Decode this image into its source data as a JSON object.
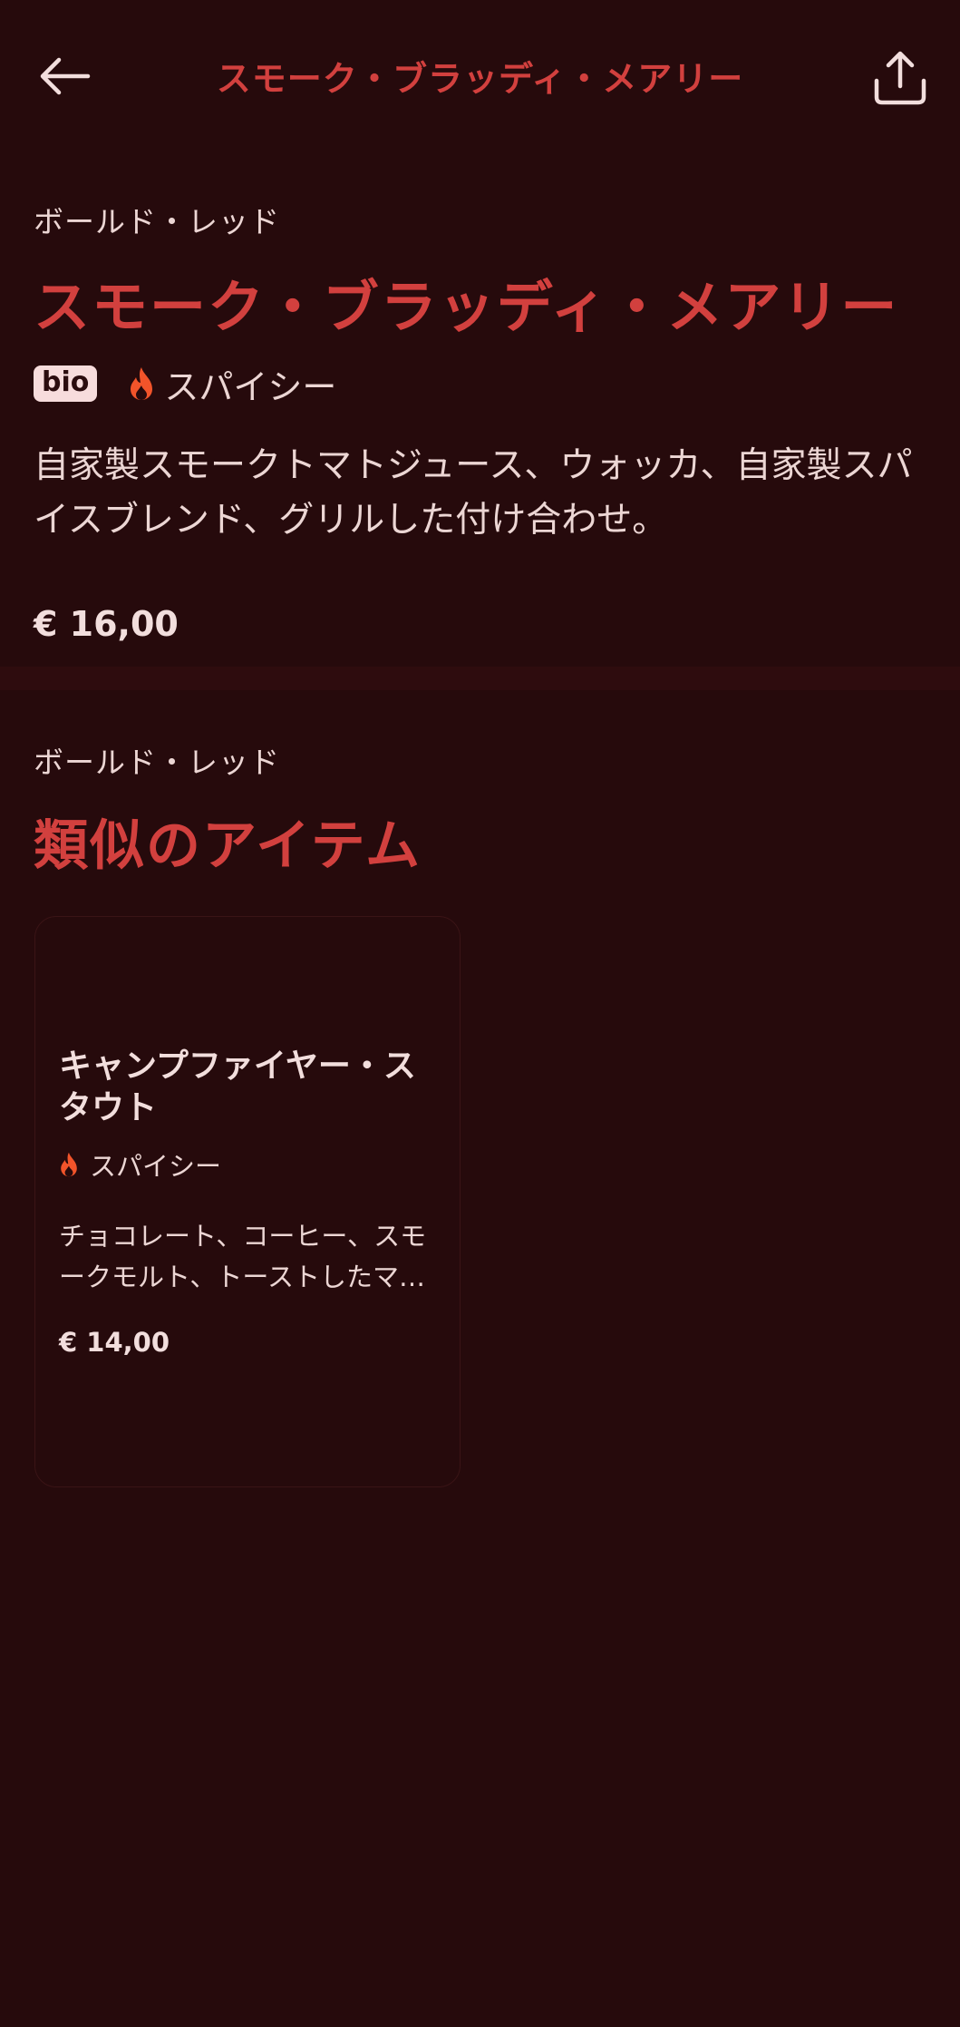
{
  "header": {
    "title": "スモーク・ブラッディ・メアリー",
    "back_icon": "arrow-left-icon",
    "share_icon": "share-icon"
  },
  "item": {
    "category": "ボールド・レッド",
    "title": "スモーク・ブラッディ・メアリー",
    "badge": "bio",
    "spicy_label": "スパイシー",
    "description": "自家製スモークトマトジュース、ウォッカ、自家製スパイスブレンド、グリルした付け合わせ。",
    "price": "€ 16,00"
  },
  "similar": {
    "category": "ボールド・レッド",
    "heading": "類似のアイテム",
    "items": [
      {
        "title": "キャンプファイヤー・スタウト",
        "spicy_label": "スパイシー",
        "description": "チョコレート、コーヒー、スモークモルト、トーストしたマシュマロ",
        "price": "€ 14,00"
      }
    ]
  },
  "colors": {
    "background": "#260a0c",
    "accent": "#d2403e",
    "flame": "#f2542a",
    "text": "#f2dedd"
  }
}
